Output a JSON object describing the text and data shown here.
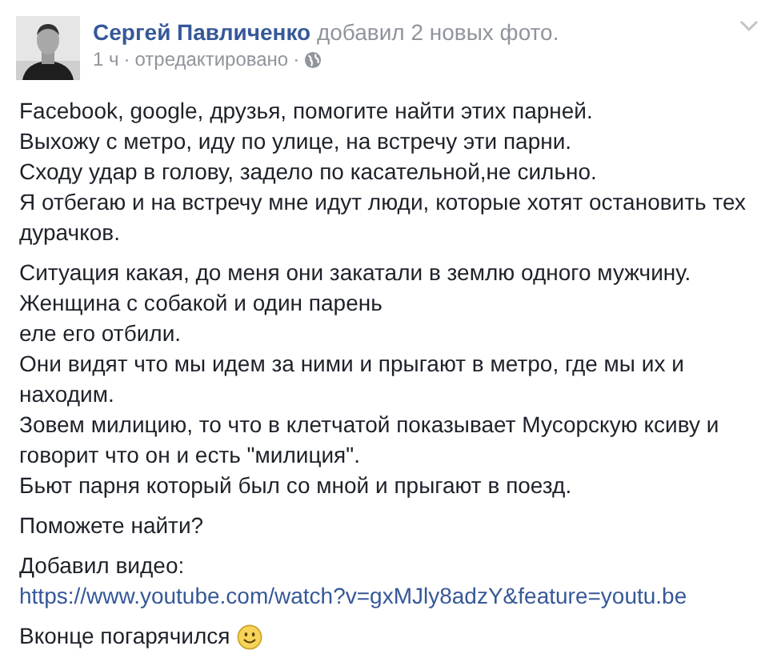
{
  "post": {
    "author": "Сергей Павличенко",
    "action": "добавил 2 новых фото.",
    "time": "1 ч",
    "edited": "отредактировано",
    "separator": "·"
  },
  "paragraphs": [
    {
      "kind": "text",
      "lines": [
        "Facebook, google, друзья, помогите найти этих парней.",
        "Выхожу с метро, иду по улице, на встречу эти парни.",
        "Сходу удар в голову, задело по касательной,не сильно.",
        "Я отбегаю и на встречу мне идут люди, которые хотят остановить тех",
        "дурачков."
      ]
    },
    {
      "kind": "text",
      "lines": [
        "Ситуация какая, до меня они закатали в землю одного мужчину.",
        "Женщина с собакой и один парень",
        "еле его отбили.",
        "Они видят что мы идем за ними и прыгают в метро, где мы их и",
        "находим.",
        "Зовем милицию, то что в клетчатой показывает Мусорскую ксиву и",
        "говорит что он и есть \"милиция\".",
        "Бьют парня который был со мной и прыгают в поезд."
      ]
    },
    {
      "kind": "text",
      "lines": [
        "Поможете найти?"
      ]
    },
    {
      "kind": "link",
      "lines": [
        "Добавил видео:"
      ],
      "link": "https://www.youtube.com/watch?v=gxMJly8adzY&feature=youtu.be"
    },
    {
      "kind": "smiley",
      "lines": [
        "Вконце погарячился"
      ]
    }
  ]
}
